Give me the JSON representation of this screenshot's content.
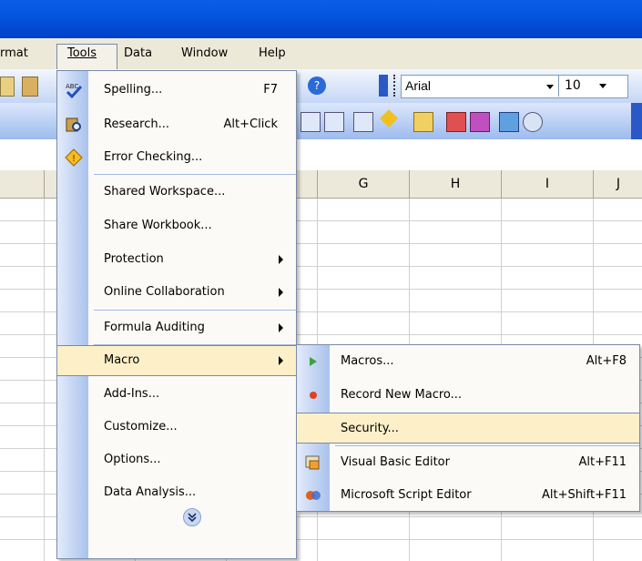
{
  "menubar": {
    "items": [
      "rmat",
      "Tools",
      "Data",
      "Window",
      "Help"
    ]
  },
  "toolbar": {
    "font_name": "Arial",
    "font_size": "10"
  },
  "columns": [
    "G",
    "H",
    "I",
    "J"
  ],
  "tools_menu": {
    "items": [
      {
        "label": "Spelling...",
        "shortcut": "F7",
        "icon": "spelling-abc-icon"
      },
      {
        "label": "Research...",
        "shortcut": "Alt+Click",
        "icon": "research-book-icon"
      },
      {
        "label": "Error Checking...",
        "shortcut": "",
        "icon": "error-checking-icon"
      },
      {
        "label": "Shared Workspace...",
        "shortcut": ""
      },
      {
        "label": "Share Workbook...",
        "shortcut": ""
      },
      {
        "label": "Protection",
        "shortcut": "",
        "submenu": true
      },
      {
        "label": "Online Collaboration",
        "shortcut": "",
        "submenu": true
      },
      {
        "label": "Formula Auditing",
        "shortcut": "",
        "submenu": true
      },
      {
        "label": "Macro",
        "shortcut": "",
        "submenu": true,
        "highlighted": true
      },
      {
        "label": "Add-Ins...",
        "shortcut": ""
      },
      {
        "label": "Customize...",
        "shortcut": ""
      },
      {
        "label": "Options...",
        "shortcut": ""
      },
      {
        "label": "Data Analysis...",
        "shortcut": ""
      }
    ],
    "expand_icon": "chevron-double-down-icon"
  },
  "macro_menu": {
    "items": [
      {
        "label": "Macros...",
        "shortcut": "Alt+F8",
        "icon": "play-arrow-icon"
      },
      {
        "label": "Record New Macro...",
        "shortcut": "",
        "icon": "record-dot-icon"
      },
      {
        "label": "Security...",
        "shortcut": "",
        "highlighted": true
      },
      {
        "label": "Visual Basic Editor",
        "shortcut": "Alt+F11",
        "icon": "vb-editor-icon"
      },
      {
        "label": "Microsoft Script Editor",
        "shortcut": "Alt+Shift+F11",
        "icon": "script-editor-icon"
      }
    ]
  },
  "colors": {
    "title_blue": "#0456e0",
    "menu_highlight": "#fdf0c8",
    "menu_border": "#7a8aa6",
    "menu_strip": "#a9c2ec"
  }
}
